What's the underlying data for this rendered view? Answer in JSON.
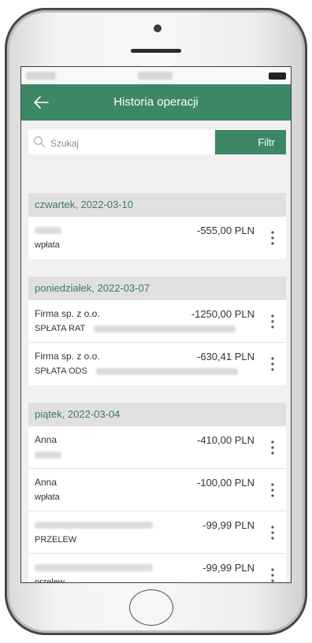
{
  "header": {
    "title": "Historia operacji",
    "back_icon": "arrow-left-icon"
  },
  "search": {
    "placeholder": "Szukaj",
    "icon": "search-icon"
  },
  "filter_button": {
    "label": "Filtr"
  },
  "colors": {
    "primary": "#3d8764",
    "date_header_text": "#3d7a5a",
    "date_header_bg": "#e0e0e0"
  },
  "groups": [
    {
      "date": "czwartek, 2022-03-10",
      "items": [
        {
          "name": "",
          "subtitle": "wpłata",
          "amount": "-555,00 PLN"
        }
      ]
    },
    {
      "date": "poniedziałek, 2022-03-07",
      "items": [
        {
          "name": "Firma sp. z o.o.",
          "subtitle": "SPŁATA RAT",
          "amount": "-1250,00 PLN"
        },
        {
          "name": "Firma sp. z o.o.",
          "subtitle": "SPŁATA ODS",
          "amount": "-630,41 PLN"
        }
      ]
    },
    {
      "date": "piątek, 2022-03-04",
      "items": [
        {
          "name": "Anna",
          "subtitle": "",
          "amount": "-410,00 PLN"
        },
        {
          "name": "Anna",
          "subtitle": "wpłata",
          "amount": "-100,00 PLN"
        },
        {
          "name": "",
          "subtitle": "PRZELEW",
          "amount": "-99,99 PLN"
        },
        {
          "name": "",
          "subtitle": "przelew",
          "amount": "-99,99 PLN"
        }
      ]
    }
  ]
}
